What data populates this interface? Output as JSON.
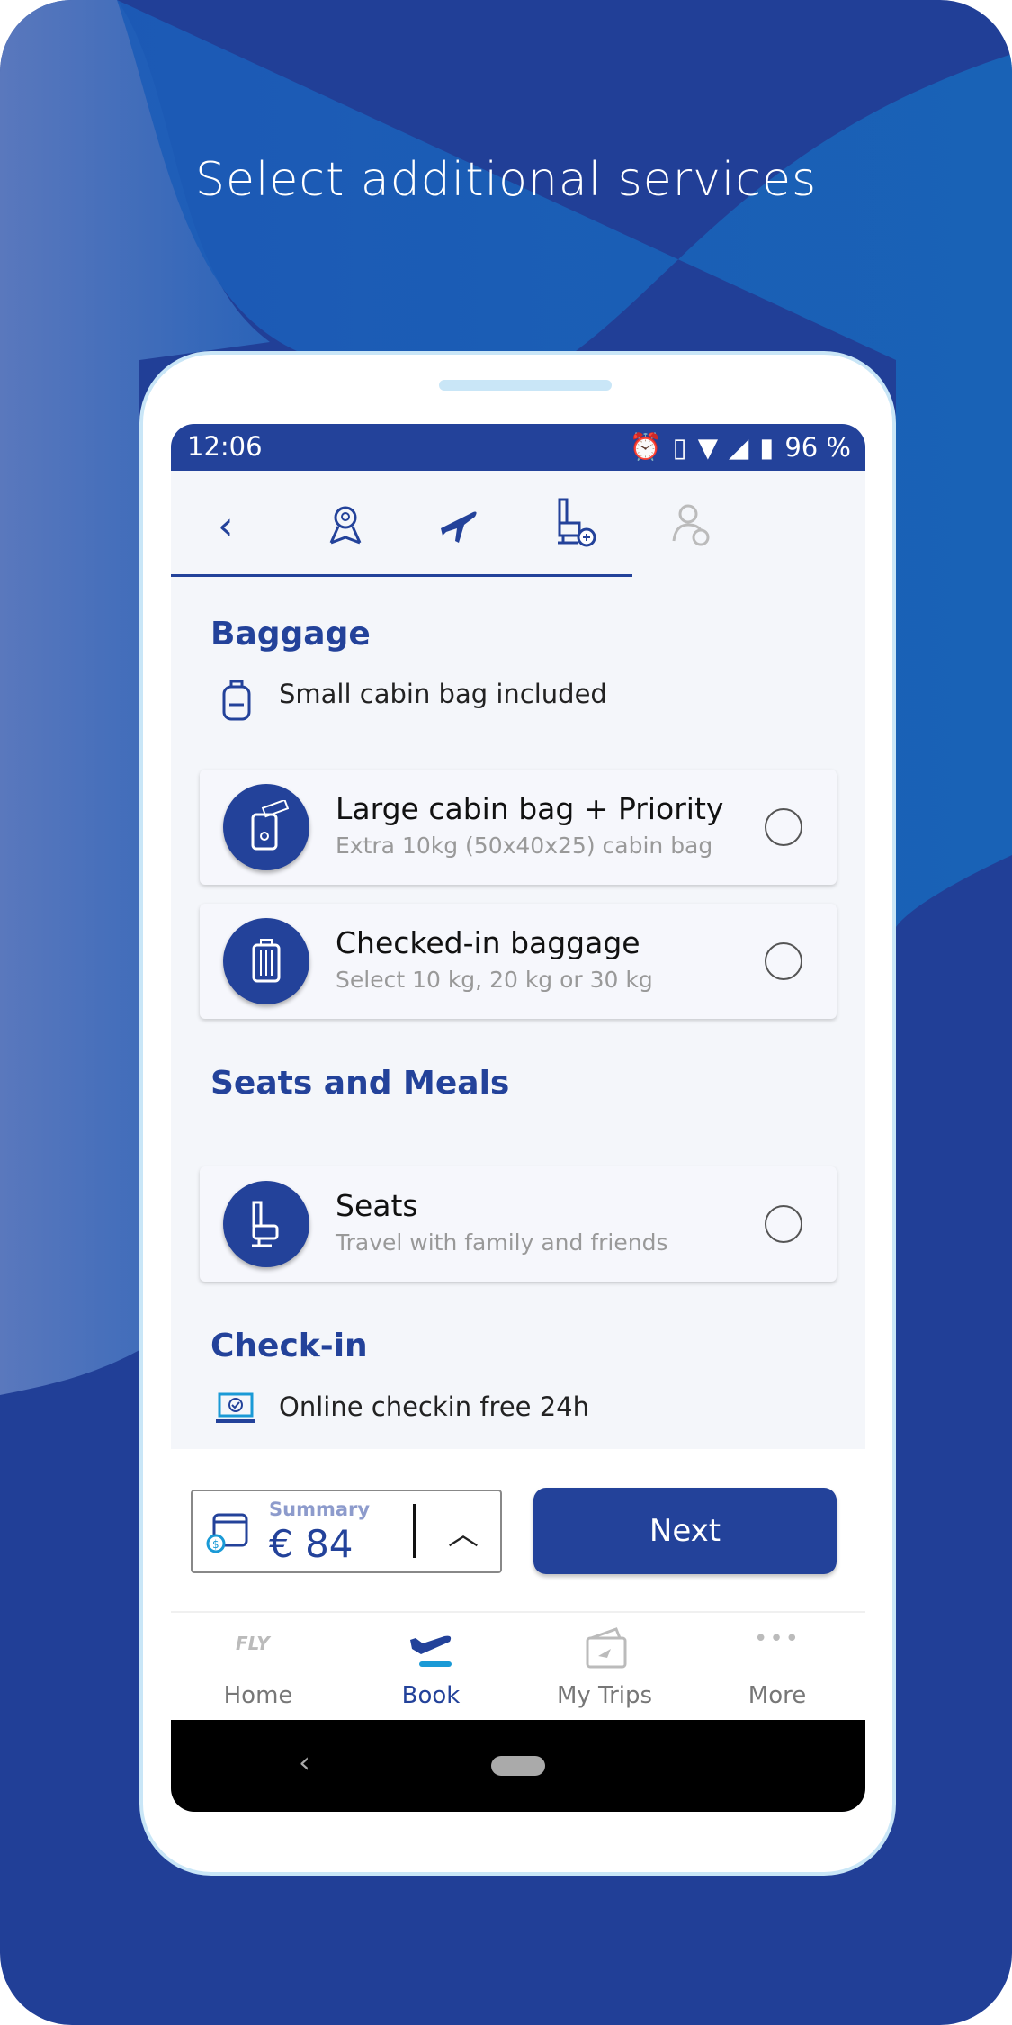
{
  "promo_title": "Select additional services",
  "status_bar": {
    "time": "12:06",
    "battery": "96 %",
    "icons": [
      "alarm-icon",
      "vibrate-icon",
      "wifi-icon",
      "signal-icon",
      "battery-icon"
    ]
  },
  "steps": {
    "icons": [
      "back-icon",
      "destination-icon",
      "flight-icon",
      "seat-extras-icon",
      "passenger-payment-icon"
    ],
    "active_index": 3
  },
  "baggage": {
    "heading": "Baggage",
    "included": "Small cabin bag included",
    "options": [
      {
        "title": "Large cabin bag + Priority",
        "subtitle": "Extra 10kg (50x40x25) cabin bag",
        "selected": false
      },
      {
        "title": "Checked-in baggage",
        "subtitle": "Select 10 kg, 20 kg or 30 kg",
        "selected": false
      }
    ]
  },
  "seats_meals": {
    "heading": "Seats and Meals",
    "options": [
      {
        "title": "Seats",
        "subtitle": "Travel with family and friends",
        "selected": false
      }
    ]
  },
  "checkin": {
    "heading": "Check-in",
    "info": "Online checkin free 24h"
  },
  "summary": {
    "label": "Summary",
    "amount": "€ 84"
  },
  "next_label": "Next",
  "nav": [
    {
      "label": "Home",
      "logo": "FLY"
    },
    {
      "label": "Book"
    },
    {
      "label": "My Trips"
    },
    {
      "label": "More"
    }
  ],
  "colors": {
    "primary": "#23429a",
    "accent": "#1a9ad6",
    "background": "#213f97"
  }
}
